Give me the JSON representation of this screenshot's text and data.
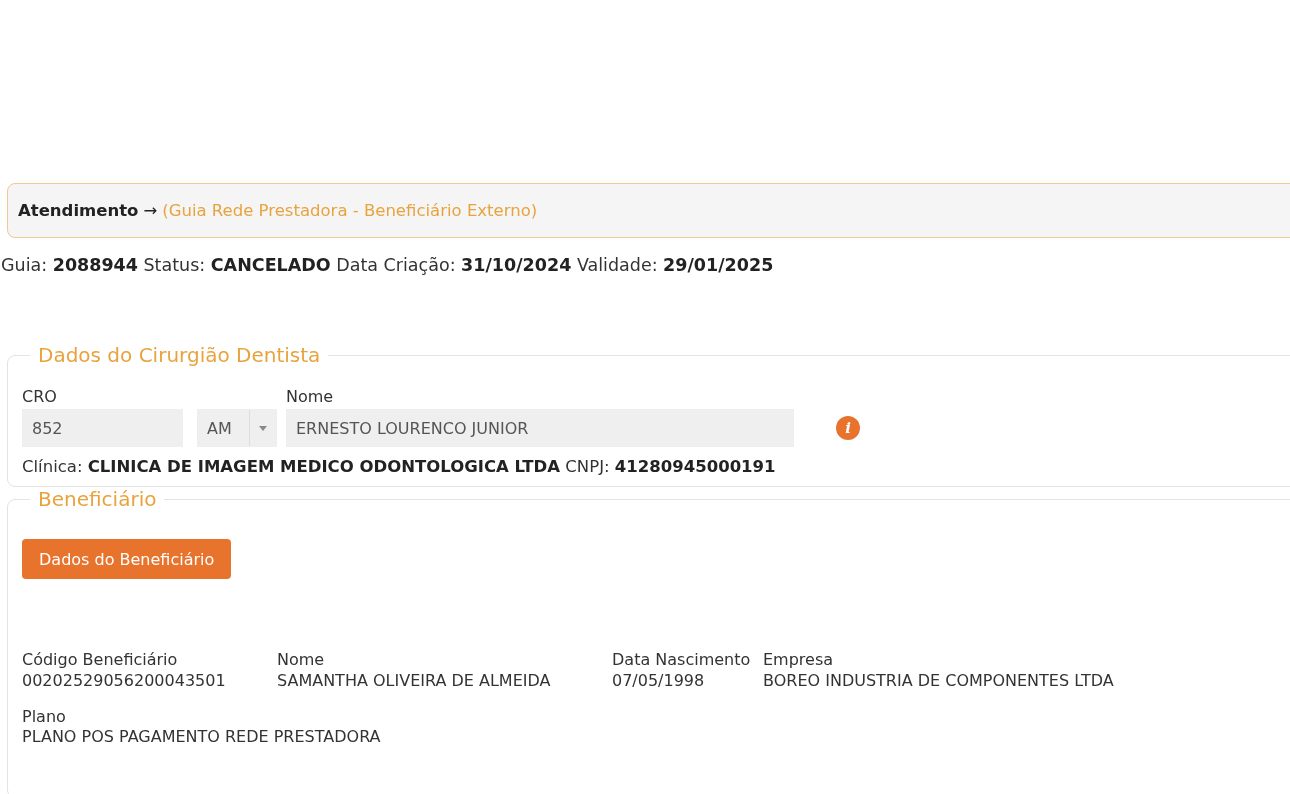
{
  "breadcrumb": {
    "title": "Atendimento",
    "arrow": "→",
    "subtitle": "(Guia Rede Prestadora - Beneficiário Externo)"
  },
  "summary": "Guia: **2088944** Status: **CANCELADO** Data Criação: **31/10/2024** Validade: **29/01/2025**",
  "dentist": {
    "legend": "Dados do Cirurgião Dentista",
    "fields": [
      {
        "kind": "input",
        "label": "CRO",
        "value": "852",
        "disabled": true
      },
      {
        "kind": "select",
        "value": "AM",
        "disabled": true
      },
      {
        "kind": "input",
        "label": "Nome",
        "value": "ERNESTO LOURENCO JUNIOR",
        "disabled": true
      }
    ],
    "info_icon": "i",
    "clinic": "Clínica: **CLINICA DE IMAGEM MEDICO ODONTOLOGICA LTDA** CNPJ: **41280945000191**"
  },
  "beneficiary": {
    "legend": "Beneficiário",
    "button": "Dados do Beneficiário",
    "details": [
      {
        "label": "Código Beneficiário",
        "value": "00202529056200043501"
      },
      {
        "label": "Nome",
        "value": "SAMANTHA OLIVEIRA DE ALMEIDA"
      },
      {
        "label": "Data Nascimento",
        "value": "07/05/1998"
      },
      {
        "label": "Empresa",
        "value": "BOREO INDUSTRIA DE COMPONENTES LTDA"
      }
    ],
    "plan": {
      "label": "Plano",
      "value": "PLANO POS PAGAMENTO REDE PRESTADORA"
    }
  }
}
